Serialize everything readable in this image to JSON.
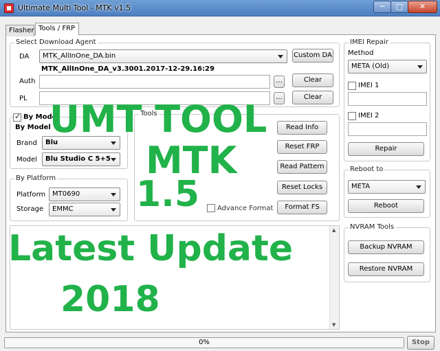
{
  "window": {
    "title": "Ultimate Multi Tool - MTK v1.5",
    "min": "─",
    "max": "□",
    "close": "✕"
  },
  "tabs": [
    {
      "label": "Flasher"
    },
    {
      "label": "Tools / FRP"
    }
  ],
  "download_agent": {
    "group_label": "Select Download Agent",
    "da_label": "DA",
    "da_value": "MTK_AllInOne_DA.bin",
    "custom_da_button": "Custom DA",
    "da_version": "MTK_AllInOne_DA_v3.3001.2017-12-29.16:29",
    "auth_label": "Auth",
    "pl_label": "PL",
    "browse": "...",
    "clear": "Clear"
  },
  "by_model": {
    "checkbox_label": "By Model",
    "group_label": "By Model",
    "brand_label": "Brand",
    "brand_value": "Blu",
    "model_label": "Model",
    "model_value": "Blu Studio C 5+5"
  },
  "by_platform": {
    "group_label": "By Platform",
    "platform_label": "Platform",
    "platform_value": "MT0690",
    "storage_label": "Storage",
    "storage_value": "EMMC"
  },
  "tools": {
    "group_label": "Tools",
    "read_info": "Read Info",
    "reset_frp": "Reset FRP",
    "read_pattern": "Read Pattern",
    "reset_locks": "Reset Locks",
    "format_fs": "Format FS",
    "advance_format": "Advance Format"
  },
  "imei_repair": {
    "group_label": "IMEI Repair",
    "method_label": "Method",
    "method_value": "META (Old)",
    "imei1_label": "IMEI 1",
    "imei2_label": "IMEI 2",
    "repair_button": "Repair"
  },
  "reboot": {
    "group_label": "Reboot to",
    "mode_value": "META",
    "reboot_button": "Reboot"
  },
  "nvram": {
    "group_label": "NVRAM Tools",
    "backup_button": "Backup NVRAM",
    "restore_button": "Restore NVRAM"
  },
  "status": {
    "progress_text": "0%",
    "progress_fraction": 0,
    "stop_button": "Stop"
  },
  "overlay": {
    "line1": "UMT TOOL",
    "line2": "MTK",
    "line3": "1.5",
    "line4": "Latest Update",
    "line5": "2018",
    "color": "#21b24a"
  }
}
